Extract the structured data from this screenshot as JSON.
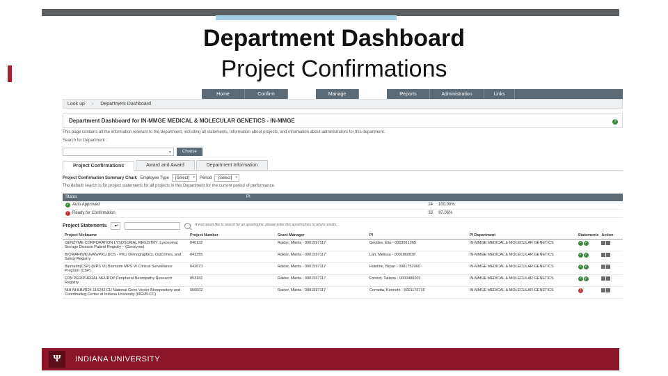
{
  "slide": {
    "title1": "Department Dashboard",
    "title2": "Project Confirmations"
  },
  "menu": {
    "items": [
      "Home",
      "Confirm",
      "Manage",
      "Reports",
      "Administration",
      "Links"
    ]
  },
  "crumbs": {
    "a": "Look up",
    "b": "Department Dashboard"
  },
  "panel": {
    "heading": "Department Dashboard for IN-MMGE MEDICAL & MOLECULAR GENETICS - IN-MMGE",
    "desc": "This page contains all the information relevant to the department, including all statements, information about projects, and information about administrators for this department.",
    "search_lbl": "Search for Department :",
    "choose": "Choose"
  },
  "tabs": {
    "a": "Project Confirmations",
    "b": "Award and Award",
    "c": "Department Information"
  },
  "summary": {
    "row_lbl": "Project Confirmation Summary Chart:",
    "etype": "Employee Type",
    "etype_val": "[Select]",
    "period": "Period",
    "period_val": "[Select]",
    "note": "The default search is for project statements for all projects in this Department for the current period of performance."
  },
  "status": {
    "h1": "Status",
    "h2": "PI",
    "rows": [
      {
        "icon": "green",
        "label": "Auto Approved",
        "count": "24",
        "pct": "100.00%"
      },
      {
        "icon": "red",
        "label": "Ready for Confirmation",
        "count": "33",
        "pct": "97.06%"
      }
    ]
  },
  "ps": {
    "title": "Project Statements",
    "filter_glyph": "▾",
    "hint": "If you would like to search for an apostrophe, please enter two apostrophes to return results."
  },
  "table": {
    "h": {
      "nick": "Project Nickname",
      "pn": "Project Number",
      "gm": "Grant Manager",
      "pi": "PI",
      "dept": "PI Department",
      "stat": "Statements",
      "act": "Action"
    },
    "rows": [
      {
        "nick": "GENZYME CORPORATION LYSOSOMAL REGISTRY: Lysosomal Storage Disease Patient Registry – (Genzyme)",
        "pn": "040132",
        "gm": "Raider, Marita - 0001597117",
        "pi": "Geddes, Ella - 0003561365",
        "dept": "IN-MMGE MEDICAL & MOLECULAR GENETICS",
        "stat": "gg"
      },
      {
        "nick": "BIOMARIN/KUVAN/PKU.DOS - PKU Demographics, Outcomes, and Safety Registry",
        "pn": "041355",
        "gm": "Raider, Marita - 0001597117",
        "pi": "Lah, Melissa - 0001860838",
        "dept": "IN-MMGE MEDICAL & MOLECULAR GENETICS",
        "stat": "gg"
      },
      {
        "nick": "Biomarin(CSP) (MPS VI) Biomarin MPS VI Clinical Surveillance Program (CSP)",
        "pn": "042673",
        "gm": "Raider, Marita - 0001597117",
        "pi": "Hainline, Bryan - 0001752960",
        "dept": "IN-MMGE MEDICAL & MOLECULAR GENETICS",
        "stat": "gg"
      },
      {
        "nick": "FDN PERIPHERAL NEUROP Peripheral Neuropathy Research Registry",
        "pn": "053182",
        "gm": "Raider, Marita - 0001597117",
        "pi": "Foroud, Tatiana - 0000480203",
        "dept": "IN-MMGE MEDICAL & MOLECULAR GENETICS",
        "stat": "gg"
      },
      {
        "nick": "NIH NHLBI/R24 116242 CU National Gene Vector Biorepository and Coordinating Center at Indiana University (NGVB-CC)",
        "pn": "056602",
        "gm": "Raider, Marita - 0001597117",
        "pi": "Cornetta, Kenneth - 0001176716",
        "dept": "IN-MMGE MEDICAL & MOLECULAR GENETICS",
        "stat": "r"
      }
    ]
  },
  "footer": {
    "iu_glyph": "Ψ",
    "iu_text": "INDIANA UNIVERSITY"
  }
}
